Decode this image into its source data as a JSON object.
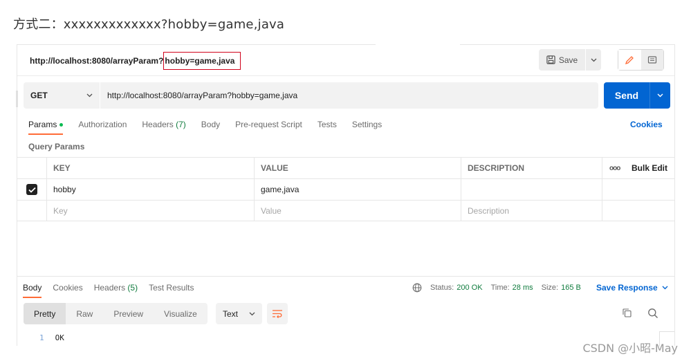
{
  "heading": "方式二：xxxxxxxxxxxxx?hobby=game,java",
  "title_bar": {
    "url_prefix": "http://localhost:8080/arrayParam?",
    "url_query": "hobby=game,java",
    "save_label": "Save"
  },
  "request": {
    "method": "GET",
    "url": "http://localhost:8080/arrayParam?hobby=game,java",
    "send_label": "Send"
  },
  "tabs": {
    "params": "Params",
    "authorization": "Authorization",
    "headers": "Headers",
    "headers_count": "(7)",
    "body": "Body",
    "prerequest": "Pre-request Script",
    "tests": "Tests",
    "settings": "Settings",
    "cookies": "Cookies"
  },
  "query_params": {
    "label": "Query Params",
    "columns": {
      "key": "KEY",
      "value": "VALUE",
      "description": "DESCRIPTION",
      "more": "ooo",
      "bulk_edit": "Bulk Edit"
    },
    "rows": [
      {
        "key": "hobby",
        "value": "game,java",
        "description": "",
        "checked": true
      }
    ],
    "placeholder": {
      "key": "Key",
      "value": "Value",
      "description": "Description"
    }
  },
  "response": {
    "tabs": {
      "body": "Body",
      "cookies": "Cookies",
      "headers": "Headers",
      "headers_count": "(5)",
      "test_results": "Test Results"
    },
    "status_label": "Status:",
    "status_value": "200 OK",
    "time_label": "Time:",
    "time_value": "28 ms",
    "size_label": "Size:",
    "size_value": "165 B",
    "save_response": "Save Response",
    "views": [
      "Pretty",
      "Raw",
      "Preview",
      "Visualize"
    ],
    "format": "Text",
    "line_number": "1",
    "content": "OK"
  },
  "watermark": "CSDN @小昭-May",
  "colors": {
    "accent_orange": "#ff6c37",
    "send_blue": "#0265d2",
    "success_green": "#0f7b3d",
    "highlight_red": "#d0021b"
  },
  "icons": [
    "save-icon",
    "chevron-down-icon",
    "pencil-icon",
    "comment-icon",
    "globe-icon",
    "copy-icon",
    "search-icon",
    "wrap-lines-icon",
    "checkbox-icon"
  ]
}
